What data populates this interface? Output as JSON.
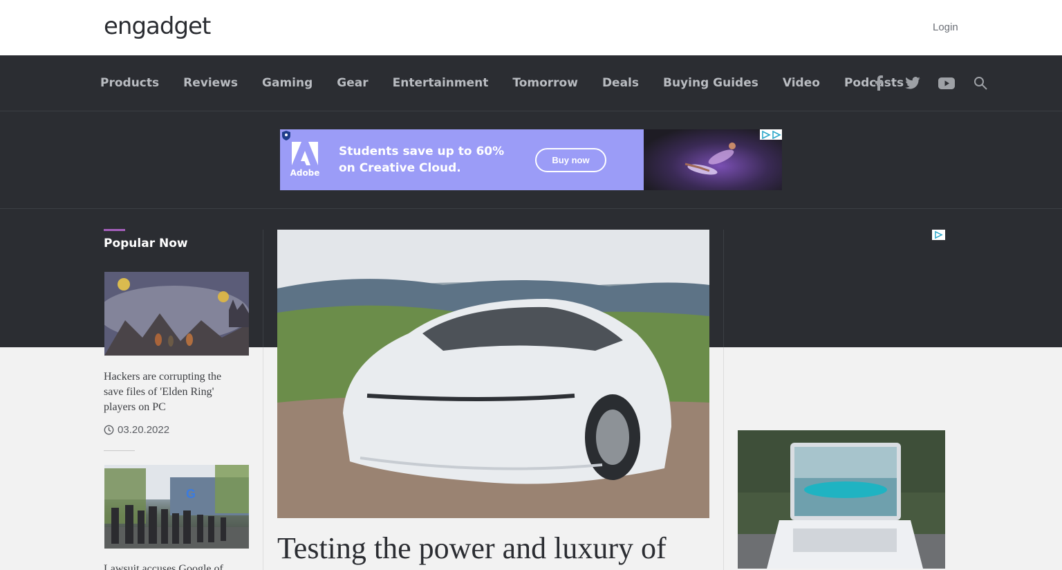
{
  "header": {
    "logo": "engadget",
    "login_label": "Login"
  },
  "nav": {
    "items": [
      {
        "label": "Products"
      },
      {
        "label": "Reviews"
      },
      {
        "label": "Gaming"
      },
      {
        "label": "Gear"
      },
      {
        "label": "Entertainment"
      },
      {
        "label": "Tomorrow"
      },
      {
        "label": "Deals"
      },
      {
        "label": "Buying Guides"
      },
      {
        "label": "Video"
      },
      {
        "label": "Podcasts"
      }
    ],
    "icons": [
      "facebook-icon",
      "twitter-icon",
      "youtube-icon",
      "search-icon"
    ]
  },
  "ad": {
    "brand": "Adobe",
    "headline": "Students save up to 60% on Creative Cloud.",
    "button_label": "Buy now"
  },
  "sidebar": {
    "title": "Popular Now",
    "items": [
      {
        "headline": "Hackers are corrupting the save files of 'Elden Ring' players on PC",
        "date": "03.20.2022"
      },
      {
        "headline": "Lawsuit accuses Google of"
      }
    ]
  },
  "hero": {
    "title": "Testing the power and luxury of"
  },
  "colors": {
    "nav_bg": "#2b2d32",
    "accent": "#a45fbc",
    "ad_bg": "#9b9cf7"
  }
}
